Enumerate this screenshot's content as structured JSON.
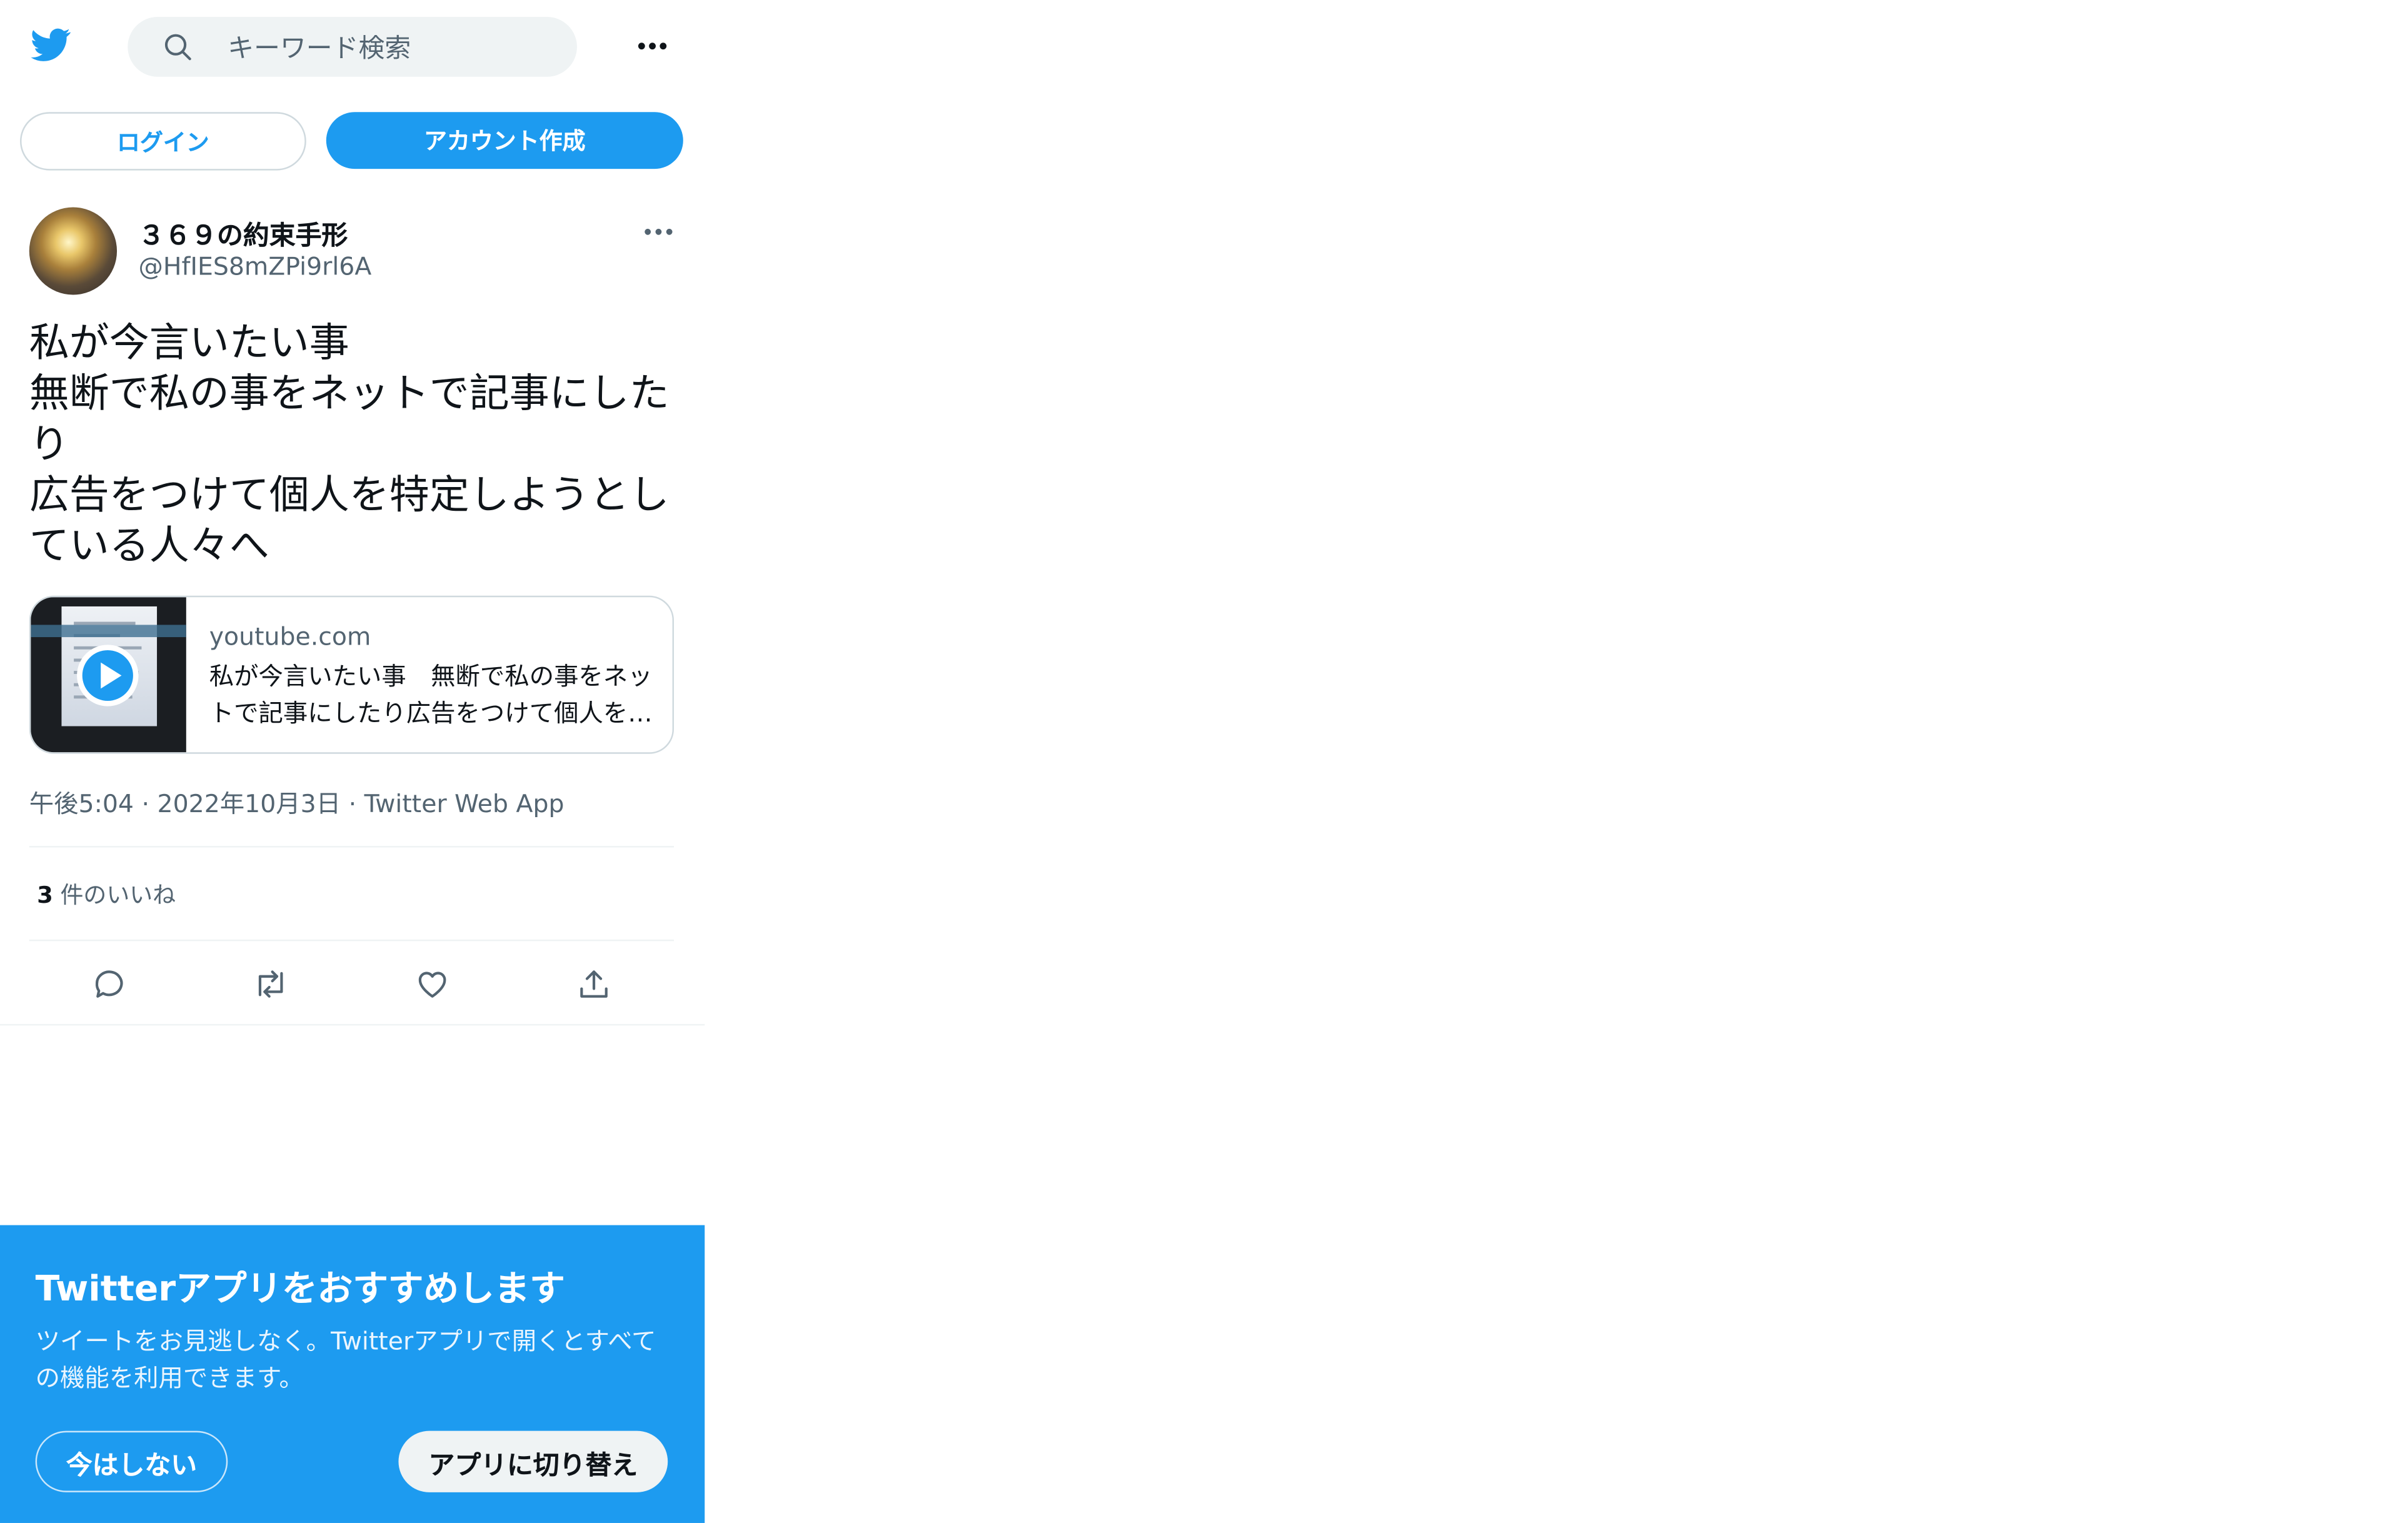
{
  "header": {
    "logo_icon": "twitter-bird-icon",
    "search_placeholder": "キーワード検索",
    "more_icon": "more-horizontal-icon"
  },
  "auth": {
    "login_label": "ログイン",
    "signup_label": "アカウント作成"
  },
  "tweet": {
    "author": {
      "display_name": "３６９の約束手形",
      "handle": "@HfIES8mZPi9rl6A"
    },
    "text": "私が今言いたい事\n無断で私の事をネットで記事にしたり\n広告をつけて個人を特定しようとしている人々へ",
    "card": {
      "domain": "youtube.com",
      "title": "私が今言いたい事　無断で私の事をネットで記事にしたり広告をつけて個人を特定しようとしている人々へ",
      "thumbnail_icon": "play-icon"
    },
    "meta": {
      "time": "午後5:04",
      "date": "2022年10月3日",
      "source": "Twitter Web App"
    },
    "likes": {
      "count": "3",
      "label": " 件のいいね"
    },
    "actions": [
      "reply-icon",
      "retweet-icon",
      "like-icon",
      "share-icon"
    ]
  },
  "app_banner": {
    "title": "Twitterアプリをおすすめします",
    "body": "ツイートをお見逃しなく。Twitterアプリで開くとすべての機能を利用できます。",
    "not_now_label": "今はしない",
    "switch_label": "アプリに切り替え"
  },
  "colors": {
    "brand_blue": "#1d9bf0",
    "text_primary": "#0f1419",
    "text_secondary": "#536471"
  }
}
